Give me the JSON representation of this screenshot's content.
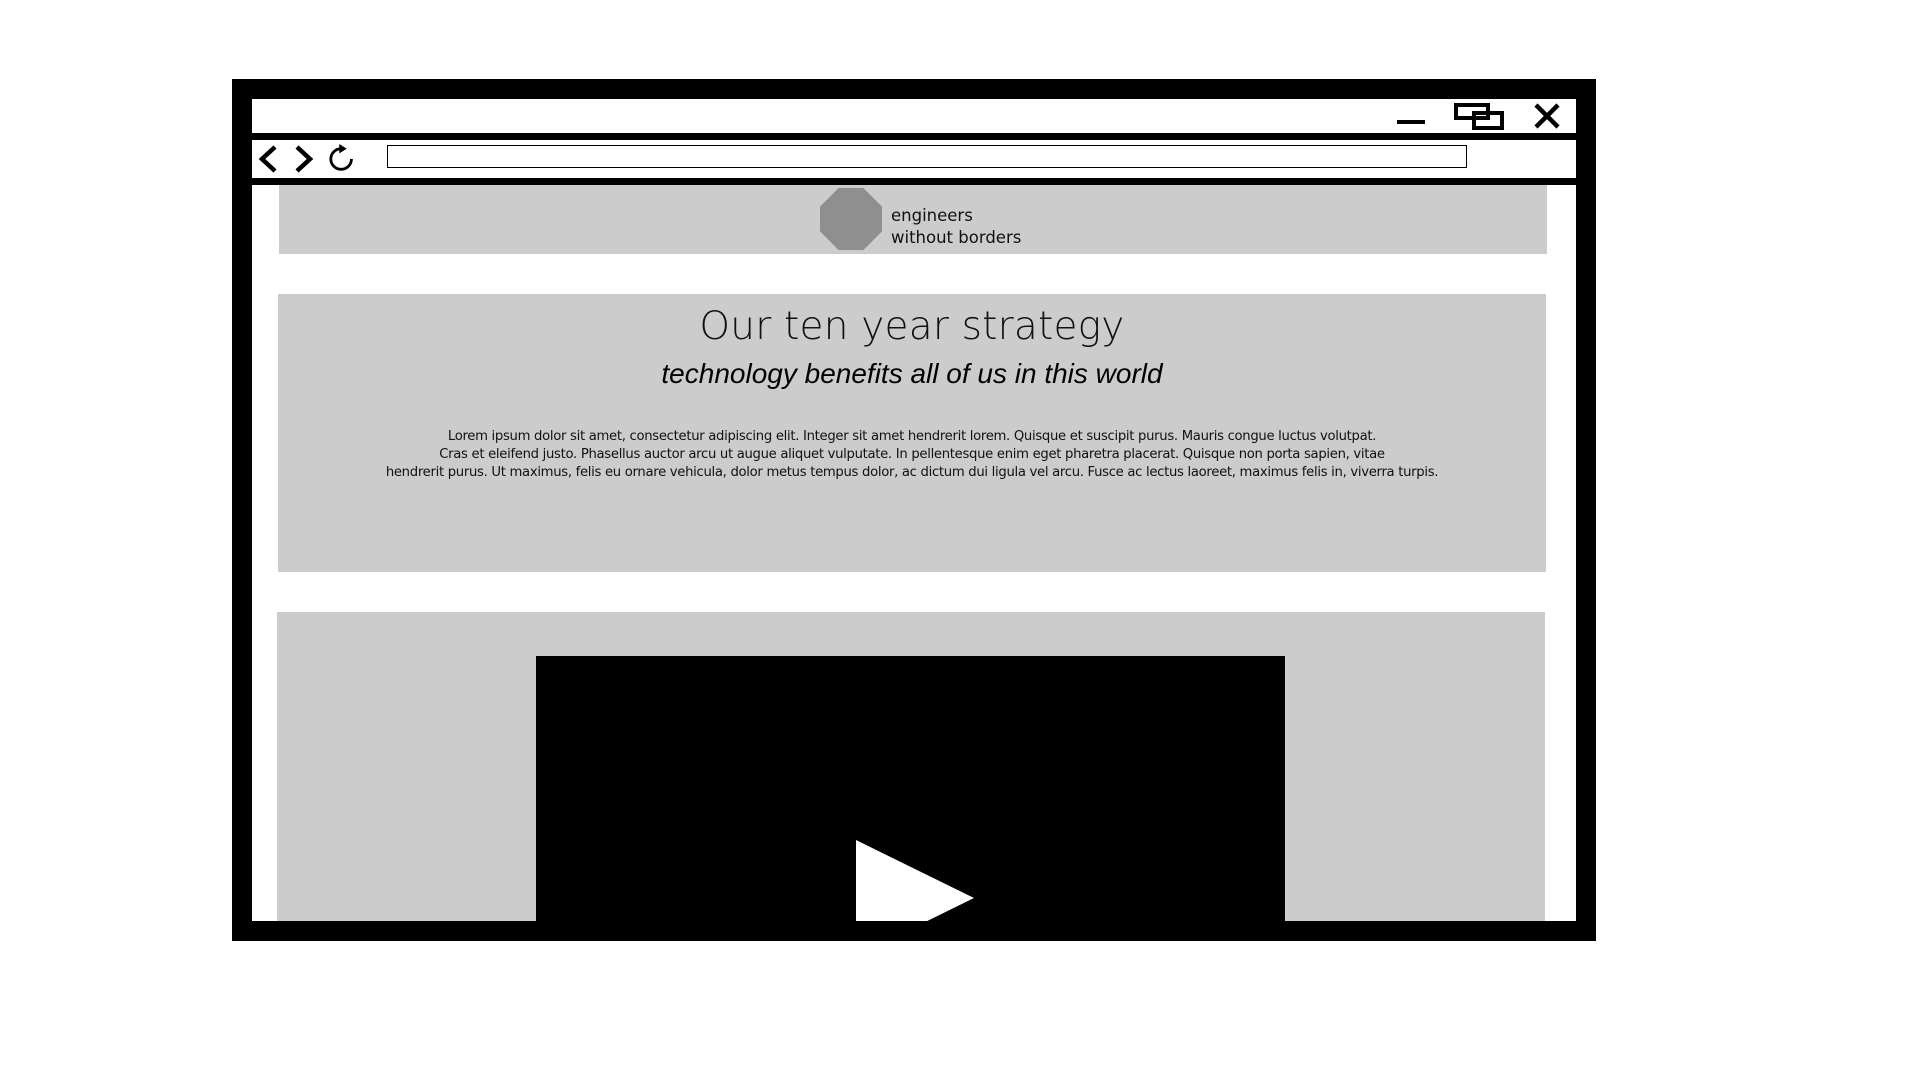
{
  "browser": {
    "address_value": ""
  },
  "site": {
    "logo_line1": "engineers",
    "logo_line2": "without borders"
  },
  "hero": {
    "title": "Our ten year strategy",
    "subtitle": "technology benefits all of us in this world",
    "body_lines": [
      "Lorem ipsum dolor sit amet, consectetur adipiscing elit. Integer sit amet hendrerit lorem. Quisque et suscipit purus. Mauris congue luctus volutpat.",
      "Cras et eleifend justo. Phasellus auctor arcu ut augue aliquet vulputate. In pellentesque enim eget pharetra placerat. Quisque non porta sapien, vitae",
      "hendrerit purus. Ut maximus, felis eu ornare vehicula, dolor metus tempus dolor, ac dictum dui ligula vel arcu. Fusce ac lectus laoreet, maximus felis in, viverra turpis."
    ]
  },
  "icons": {
    "minimize": "minimize-icon",
    "maximize": "restore-icon",
    "close": "close-icon",
    "back": "chevron-left-icon",
    "forward": "chevron-right-icon",
    "reload": "reload-icon",
    "logo": "octagon-logo-icon",
    "play": "play-icon"
  },
  "colors": {
    "frame": "#000000",
    "panel": "#cccccc",
    "logo": "#8f8f8f",
    "video": "#000000"
  }
}
